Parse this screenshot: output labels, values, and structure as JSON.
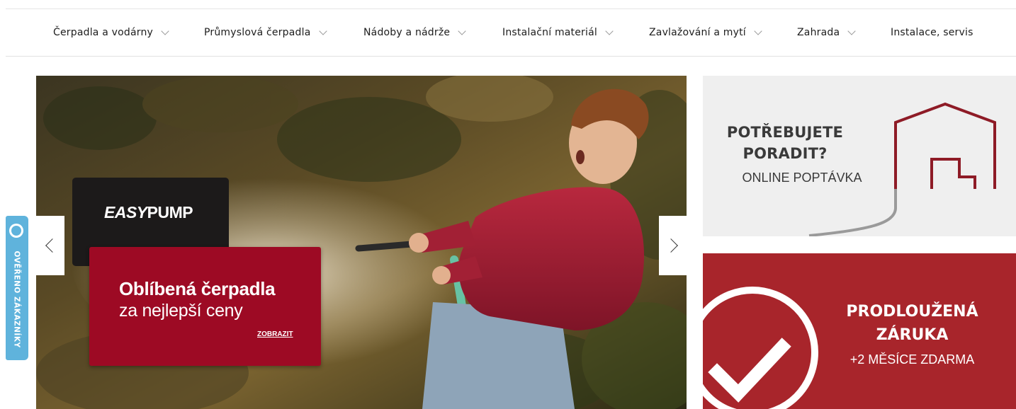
{
  "nav": {
    "items": [
      {
        "label": "Čerpadla a vodárny",
        "has_dropdown": true
      },
      {
        "label": "Průmyslová čerpadla",
        "has_dropdown": true
      },
      {
        "label": "Nádoby a nádrže",
        "has_dropdown": true
      },
      {
        "label": "Instalační materiál",
        "has_dropdown": true
      },
      {
        "label": "Zavlažování a mytí",
        "has_dropdown": true
      },
      {
        "label": "Zahrada",
        "has_dropdown": true
      },
      {
        "label": "Instalace, servis",
        "has_dropdown": false
      }
    ]
  },
  "slider": {
    "brand_prefix": "EASY",
    "brand_suffix": "PUMP",
    "promo_title": "Oblíbená čerpadla",
    "promo_subtitle": "za nejlepší ceny",
    "promo_link": "ZOBRAZIT",
    "prev_icon": "chevron-left-icon",
    "next_icon": "chevron-right-icon"
  },
  "advice_banner": {
    "title_line1": "POTŘEBUJETE",
    "title_line2": "PORADIT?",
    "subtitle": "ONLINE POPTÁVKA",
    "icon": "house-outline-icon"
  },
  "warranty_banner": {
    "title_line1": "PRODLOUŽENÁ",
    "title_line2": "ZÁRUKA",
    "subtitle": "+2 MĚSÍCE ZDARMA",
    "icon": "checkmark-circle-icon"
  },
  "verified_tab": {
    "label": "OVĚŘENO ZÁKAZNÍKY",
    "icon": "verified-badge-icon"
  },
  "colors": {
    "promo_red": "#9d0a24",
    "warranty_red": "#a8252b",
    "brand_dark": "#1c1a1a",
    "verified_blue": "#5fb3dc",
    "advice_bg": "#efefef",
    "house_line": "#8e1b26"
  }
}
